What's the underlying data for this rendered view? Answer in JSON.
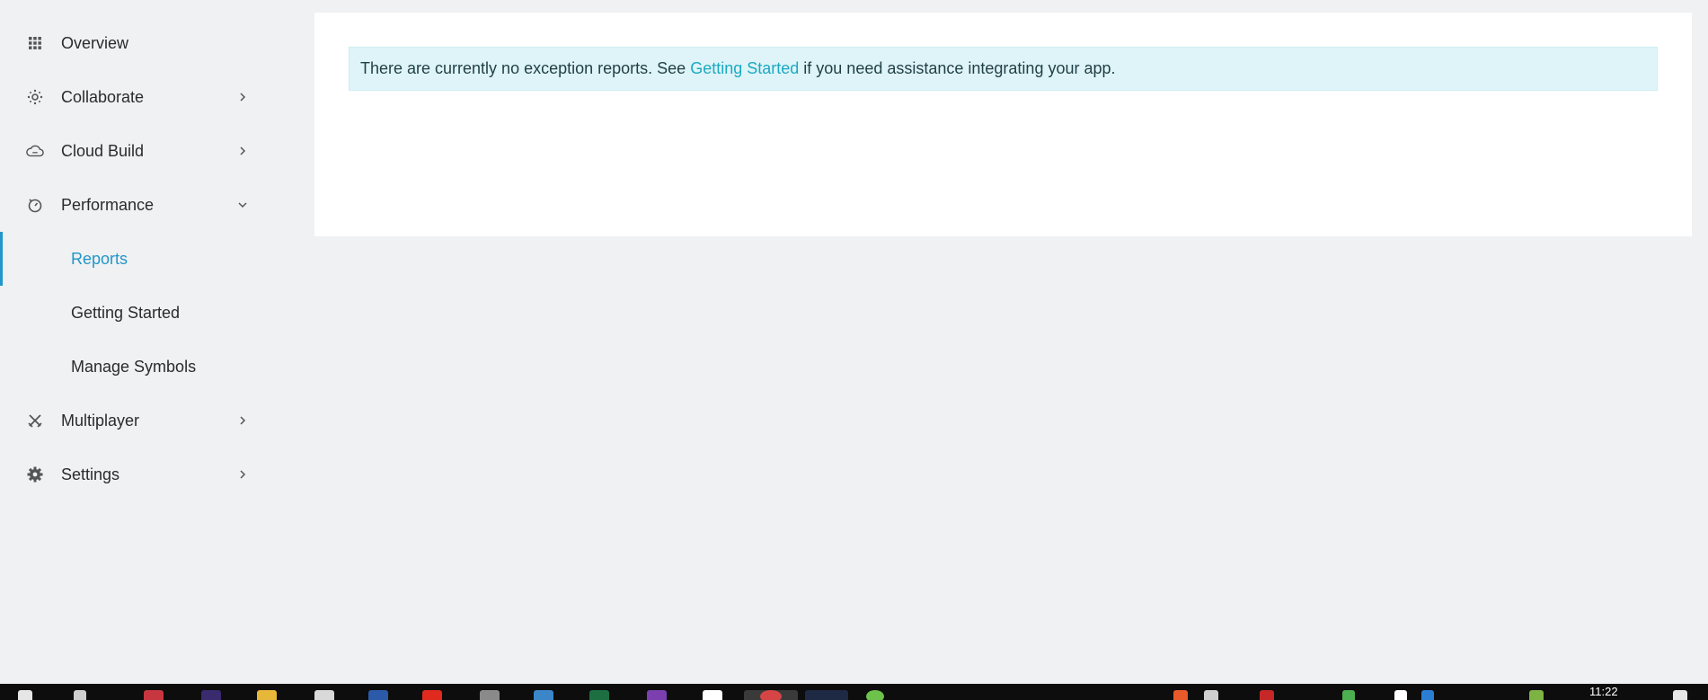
{
  "sidebar": {
    "items": [
      {
        "label": "Overview",
        "icon": "grid-icon"
      },
      {
        "label": "Collaborate",
        "icon": "collaborate-icon",
        "chevron": "chevron-right-icon"
      },
      {
        "label": "Cloud Build",
        "icon": "cloud-icon",
        "chevron": "chevron-right-icon"
      },
      {
        "label": "Performance",
        "icon": "stopwatch-icon",
        "chevron": "chevron-down-icon",
        "expanded": true
      },
      {
        "label": "Multiplayer",
        "icon": "crossed-swords-icon",
        "chevron": "chevron-right-icon"
      },
      {
        "label": "Settings",
        "icon": "gear-icon",
        "chevron": "chevron-right-icon"
      }
    ],
    "performance_subitems": [
      {
        "label": "Reports",
        "active": true
      },
      {
        "label": "Getting Started"
      },
      {
        "label": "Manage Symbols"
      }
    ],
    "active_color": "#2196c9"
  },
  "main": {
    "alert": {
      "text_before": "There are currently no exception reports. See",
      "link_text": "Getting Started",
      "text_after": "if you need assistance integrating your app.",
      "background": "#dff4f8",
      "link_color": "#1aa9c2"
    }
  },
  "taskbar": {
    "clock": "11:22"
  }
}
